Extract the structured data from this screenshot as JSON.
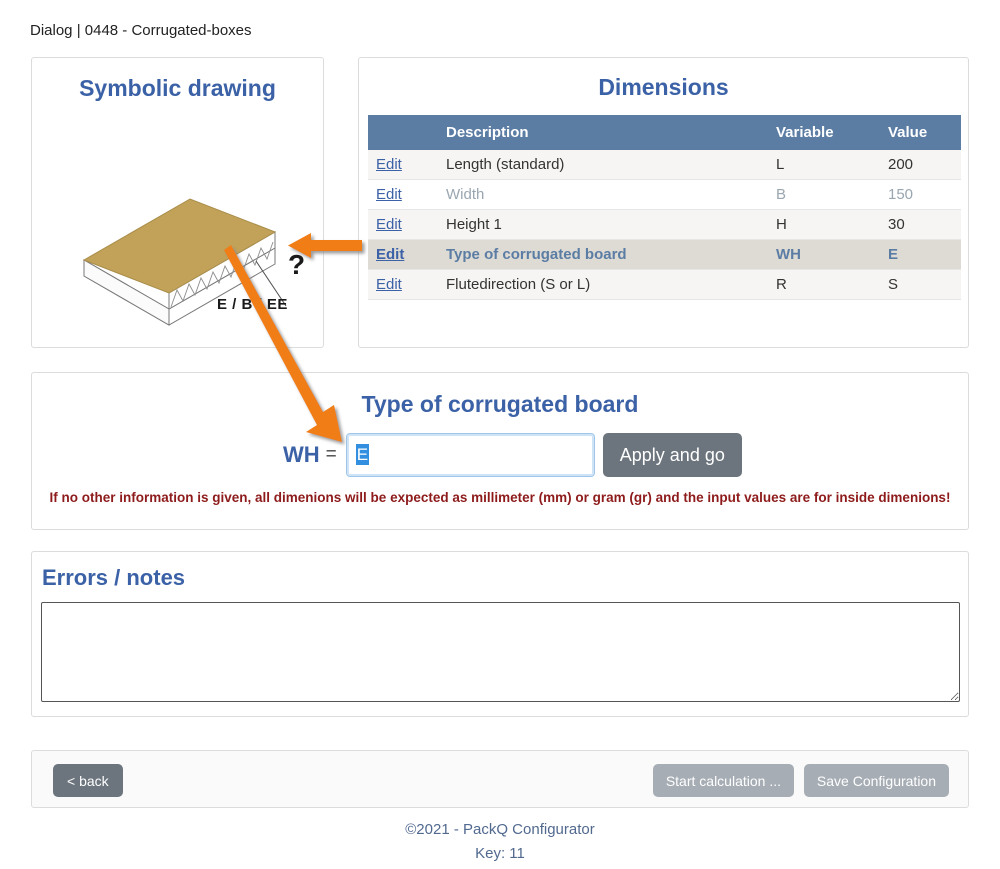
{
  "breadcrumb": "Dialog | 0448 - Corrugated-boxes",
  "symbolic": {
    "title": "Symbolic drawing",
    "question_mark": "?",
    "board_types_label": "E / B / EE"
  },
  "dimensions": {
    "title": "Dimensions",
    "columns": [
      "",
      "Description",
      "Variable",
      "Value"
    ],
    "edit_label": "Edit",
    "rows": [
      {
        "description": "Length (standard)",
        "variable": "L",
        "value": "200",
        "state": "normal"
      },
      {
        "description": "Width",
        "variable": "B",
        "value": "150",
        "state": "muted"
      },
      {
        "description": "Height 1",
        "variable": "H",
        "value": "30",
        "state": "normal"
      },
      {
        "description": "Type of corrugated board",
        "variable": "WH",
        "value": "E",
        "state": "highlighted"
      },
      {
        "description": "Flutedirection (S or L)",
        "variable": "R",
        "value": "S",
        "state": "normal"
      }
    ]
  },
  "input_panel": {
    "title": "Type of corrugated board",
    "field_label": "WH",
    "equals": "=",
    "field_value": "E",
    "field_placeholder": "",
    "apply_label": "Apply and go",
    "warning": "If no other information is given, all dimenions will be expected as millimeter (mm) or gram (gr) and the input values are for inside dimenions!"
  },
  "errors": {
    "title": "Errors / notes",
    "value": "",
    "placeholder": ""
  },
  "actions": {
    "back_label": "< back",
    "start_calculation_label": "Start calculation ...",
    "save_configuration_label": "Save Configuration"
  },
  "footer": {
    "copyright": "©2021 - PackQ Configurator",
    "key": "Key: 11"
  },
  "colors": {
    "heading_blue": "#3b61a6",
    "table_header": "#5b7da4",
    "highlight_row": "#dedad4",
    "accent_orange": "#f07d18",
    "warning_red": "#8e1b1b",
    "board_tan": "#c2a258",
    "button_gray": "#6c757d",
    "button_light_gray": "#a6adb4",
    "footer_text": "#51698f"
  }
}
